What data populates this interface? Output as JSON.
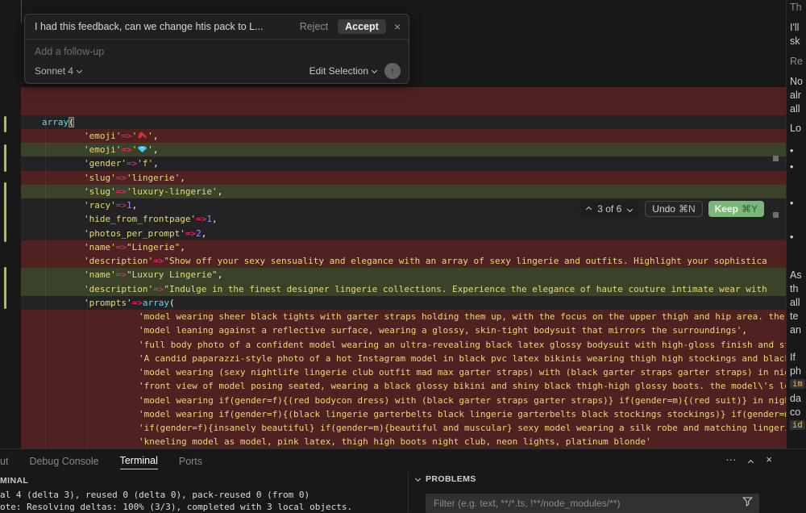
{
  "colors": {
    "diff_removed_bg": "#4f2221",
    "diff_added_bg": "#3a432a",
    "keep_button_bg": "#7ab87a",
    "gutter_change_bar": "#a3c64b",
    "token_string": "#e6db74",
    "token_operator": "#f92672",
    "token_number": "#ae81ff",
    "token_keyword": "#66d9ef"
  },
  "inline_chat": {
    "prompt": "I had this feedback, can we change htis pack to L...",
    "reject_label": "Reject",
    "accept_label": "Accept",
    "close_glyph": "×",
    "followup_placeholder": "Add a follow-up",
    "model_selector": "Sonnet 4",
    "mode_selector": "Edit Selection",
    "send_glyph": "↑"
  },
  "diff_nav": {
    "position": "3 of 6",
    "undo_label": "Undo",
    "undo_shortcut": "⌘N",
    "keep_label": "Keep",
    "keep_shortcut": "⌘Y"
  },
  "editor": {
    "lines": [
      {
        "type": "del",
        "indent": 0,
        "segs": []
      },
      {
        "type": "del",
        "indent": 0,
        "segs": []
      },
      {
        "type": "ctx",
        "indent": 0,
        "segs": [
          {
            "t": "array",
            "c": "k"
          },
          {
            "t": "(",
            "c": "b"
          }
        ]
      },
      {
        "type": "del",
        "indent": 1,
        "segs": [
          {
            "t": "'emoji'",
            "c": "s"
          },
          {
            "t": "=>",
            "c": "o"
          },
          {
            "t": "'",
            "c": "s"
          },
          {
            "icon": "high-heel-emoji",
            "t": "👠"
          },
          {
            "t": "'",
            "c": "s"
          },
          {
            "t": ",",
            "c": "p"
          }
        ]
      },
      {
        "type": "add",
        "indent": 1,
        "segs": [
          {
            "t": "'emoji'",
            "c": "s"
          },
          {
            "t": "=>",
            "c": "o"
          },
          {
            "t": "'",
            "c": "s"
          },
          {
            "icon": "gem-emoji",
            "t": "💎"
          },
          {
            "t": "'",
            "c": "s"
          },
          {
            "t": ",",
            "c": "p"
          }
        ]
      },
      {
        "type": "ctx",
        "indent": 1,
        "segs": [
          {
            "t": "'gender'",
            "c": "s"
          },
          {
            "t": "=>",
            "c": "o"
          },
          {
            "t": "'f'",
            "c": "s"
          },
          {
            "t": ",",
            "c": "p"
          }
        ]
      },
      {
        "type": "del",
        "indent": 1,
        "segs": [
          {
            "t": "'slug'",
            "c": "s"
          },
          {
            "t": "=>",
            "c": "o"
          },
          {
            "t": "'lingerie'",
            "c": "s"
          },
          {
            "t": ",",
            "c": "p"
          }
        ]
      },
      {
        "type": "add",
        "indent": 1,
        "segs": [
          {
            "t": "'slug'",
            "c": "s"
          },
          {
            "t": "=>",
            "c": "o"
          },
          {
            "t": "'luxury-lingerie'",
            "c": "s"
          },
          {
            "t": ",",
            "c": "p"
          }
        ]
      },
      {
        "type": "ctx",
        "indent": 1,
        "segs": [
          {
            "t": "'racy'",
            "c": "s"
          },
          {
            "t": "=>",
            "c": "o"
          },
          {
            "t": "1",
            "c": "n"
          },
          {
            "t": ",",
            "c": "p"
          }
        ]
      },
      {
        "type": "ctx",
        "indent": 1,
        "segs": [
          {
            "t": "'hide_from_frontpage'",
            "c": "s"
          },
          {
            "t": "=>",
            "c": "o"
          },
          {
            "t": "1",
            "c": "n"
          },
          {
            "t": ",",
            "c": "p"
          }
        ]
      },
      {
        "type": "ctx",
        "indent": 1,
        "segs": [
          {
            "t": "'photos_per_prompt'",
            "c": "s"
          },
          {
            "t": "=>",
            "c": "o"
          },
          {
            "t": "2",
            "c": "n"
          },
          {
            "t": ",",
            "c": "p"
          }
        ]
      },
      {
        "type": "del",
        "indent": 1,
        "segs": [
          {
            "t": "'name'",
            "c": "s"
          },
          {
            "t": "=>",
            "c": "o"
          },
          {
            "t": "\"Lingerie\"",
            "c": "s"
          },
          {
            "t": ",",
            "c": "p"
          }
        ]
      },
      {
        "type": "del",
        "indent": 1,
        "segs": [
          {
            "t": "'description'",
            "c": "s"
          },
          {
            "t": "=>",
            "c": "o"
          },
          {
            "t": "\"Show off your sexy sensuality and elegance with an array of sexy lingerie and outfits. Highlight your sophistica",
            "c": "s"
          }
        ]
      },
      {
        "type": "add",
        "indent": 1,
        "segs": [
          {
            "t": "'name'",
            "c": "s"
          },
          {
            "t": "=>",
            "c": "o"
          },
          {
            "t": "\"Luxury Lingerie\"",
            "c": "s"
          },
          {
            "t": ",",
            "c": "p"
          }
        ]
      },
      {
        "type": "add",
        "indent": 1,
        "segs": [
          {
            "t": "'description'",
            "c": "s"
          },
          {
            "t": "=>",
            "c": "o"
          },
          {
            "t": "\"Indulge in the finest designer lingerie collections. Experience the elegance of haute couture intimate wear with",
            "c": "s"
          }
        ]
      },
      {
        "type": "ctx",
        "indent": 1,
        "segs": [
          {
            "t": "'prompts'",
            "c": "s"
          },
          {
            "t": "=>",
            "c": "o"
          },
          {
            "t": "array",
            "c": "k"
          },
          {
            "t": "(",
            "c": "p"
          }
        ]
      },
      {
        "type": "del",
        "indent": 2,
        "segs": [
          {
            "t": "'model wearing sheer black tights with garter straps holding them up, with the focus on the upper thigh and hip area. the fa",
            "c": "s"
          }
        ]
      },
      {
        "type": "del",
        "indent": 2,
        "segs": [
          {
            "t": "'model leaning against a reflective surface, wearing a glossy, skin-tight bodysuit that mirrors the surroundings'",
            "c": "s"
          },
          {
            "t": ",",
            "c": "p"
          }
        ]
      },
      {
        "type": "del",
        "indent": 2,
        "segs": [
          {
            "t": "'full body photo of a confident model wearing an ultra-revealing black latex glossy bodysuit with high-gloss finish and stra",
            "c": "s"
          }
        ]
      },
      {
        "type": "del",
        "indent": 2,
        "segs": [
          {
            "t": "'A candid paparazzi-style photo of a hot Instagram model in black pvc latex bikinis wearing thigh high stockings and black c",
            "c": "s"
          }
        ]
      },
      {
        "type": "del",
        "indent": 2,
        "segs": [
          {
            "t": "'model wearing (sexy nightlife lingerie club outfit mad max garter straps) with (black garter straps garter straps) in night",
            "c": "s"
          }
        ]
      },
      {
        "type": "del",
        "indent": 2,
        "segs": [
          {
            "t": "'front view of model posing seated, wearing a black glossy bikini and shiny black thigh-high glossy boots. the model\\'s long",
            "c": "s"
          }
        ]
      },
      {
        "type": "del",
        "indent": 2,
        "segs": [
          {
            "t": "'model wearing if(gender=f){(red bodycon dress) with (black garter straps garter straps)} if(gender=m){(red suit)} in night ",
            "c": "s"
          }
        ]
      },
      {
        "type": "del",
        "indent": 2,
        "segs": [
          {
            "t": "'model wearing if(gender=f){(black lingerie garterbelts black lingerie garterbelts black stockings stockings)} if(gender=m){",
            "c": "s"
          }
        ]
      },
      {
        "type": "del",
        "indent": 2,
        "segs": [
          {
            "t": "'if(gender=f){insanely beautiful} if(gender=m){beautiful and muscular} sexy model wearing a silk robe and matching lingerie ",
            "c": "s"
          }
        ]
      },
      {
        "type": "del",
        "indent": 2,
        "segs": [
          {
            "t": "'kneeling model as model, pink latex, thigh high boots night club, neon lights, platinum blonde'",
            "c": "s"
          }
        ]
      }
    ]
  },
  "chat_panel": {
    "lines": [
      {
        "t": "Th",
        "kind": "muted"
      },
      {
        "t": "I'll",
        "kind": "text"
      },
      {
        "t": "sk",
        "kind": "text"
      },
      {
        "t": "Re",
        "kind": "muted"
      },
      {
        "t": "No",
        "kind": "text"
      },
      {
        "t": "alr",
        "kind": "text"
      },
      {
        "t": "all",
        "kind": "text"
      },
      {
        "t": "Lo",
        "kind": "text"
      },
      {
        "t": "•",
        "kind": "text"
      },
      {
        "t": "•",
        "kind": "text"
      },
      {
        "t": "•",
        "kind": "text"
      },
      {
        "t": "•",
        "kind": "text"
      },
      {
        "t": "As",
        "kind": "text"
      },
      {
        "t": "th",
        "kind": "text"
      },
      {
        "t": "all",
        "kind": "text"
      },
      {
        "t": "te",
        "kind": "text"
      },
      {
        "t": "an",
        "kind": "text"
      },
      {
        "t": "If",
        "kind": "text"
      },
      {
        "t": "ph",
        "kind": "text"
      },
      {
        "t": "im",
        "kind": "chip"
      },
      {
        "t": "da",
        "kind": "text"
      },
      {
        "t": "co",
        "kind": "text"
      },
      {
        "t": "id",
        "kind": "chip"
      }
    ]
  },
  "bottom_panel": {
    "tabs": [
      {
        "label": "ut",
        "active": false
      },
      {
        "label": "Debug Console",
        "active": false
      },
      {
        "label": "Terminal",
        "active": true
      },
      {
        "label": "Ports",
        "active": false
      }
    ],
    "icons": {
      "more": "···",
      "maximize": "chevron-up",
      "close": "×"
    },
    "terminal": {
      "header": "MINAL",
      "lines": [
        "al 4 (delta 3), reused 0 (delta 0), pack-reused 0 (from 0)",
        "ote: Resolving deltas: 100% (3/3), completed with 3 local objects."
      ]
    },
    "problems": {
      "header": "PROBLEMS",
      "filter_placeholder": "Filter (e.g. text, **/*.ts, !**/node_modules/**)"
    }
  }
}
